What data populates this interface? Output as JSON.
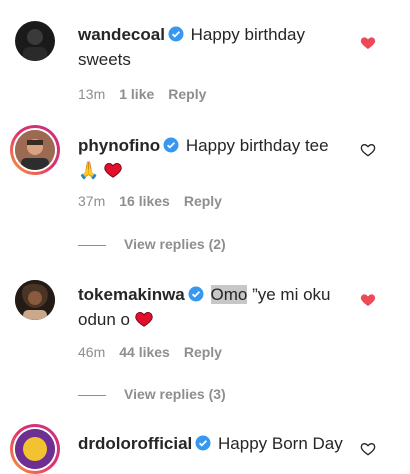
{
  "comments": [
    {
      "username": "wandecoal",
      "text": "Happy birthday sweets",
      "time": "13m",
      "likes": "1 like",
      "reply": "Reply",
      "liked": true
    },
    {
      "username": "phynofino",
      "text": "Happy birthday tee",
      "emoji": "🙏",
      "time": "37m",
      "likes": "16 likes",
      "reply": "Reply",
      "liked": false,
      "view_replies": "View replies (2)"
    },
    {
      "username": "tokemakinwa",
      "highlight": "Omo",
      "text": "”ye mi oku odun o",
      "time": "46m",
      "likes": "44 likes",
      "reply": "Reply",
      "liked": true,
      "view_replies": "View replies (3)"
    },
    {
      "username": "drdolorofficial",
      "text": "Happy Born Day",
      "liked": false
    }
  ],
  "colors": {
    "heart": "#ed4956",
    "verified": "#3897f0",
    "meta": "#8e8e8e"
  }
}
